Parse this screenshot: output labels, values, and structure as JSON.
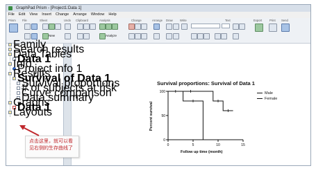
{
  "window": {
    "title": "GraphPad Prism - [Project1:Data 1]"
  },
  "menu": [
    "File",
    "Edit",
    "View",
    "Insert",
    "Change",
    "Arrange",
    "Window",
    "Help"
  ],
  "toolbar": {
    "groups": [
      "Prism",
      "File",
      "Sheet",
      "Undo",
      "Clipboard",
      "Analysis",
      "Change",
      "Arrange",
      "Draw",
      "Write",
      "Text",
      "Export",
      "Print",
      "Send"
    ],
    "new_label": "New",
    "analyze_label": "Analyze",
    "font_combo": "",
    "size_combo": ""
  },
  "navigator": {
    "items": [
      {
        "label": "Family",
        "kind": "folder"
      },
      {
        "label": "Search results",
        "kind": "folder"
      },
      {
        "label": "Data Tables",
        "kind": "folder"
      },
      {
        "label": "Data 1",
        "kind": "doc"
      },
      {
        "label": "Info",
        "kind": "folder"
      },
      {
        "label": "Project info 1",
        "kind": "info"
      },
      {
        "label": "Results",
        "kind": "folder"
      },
      {
        "label": "Survival of Data 1",
        "kind": "folder"
      },
      {
        "label": "Survival proportions",
        "kind": "doc"
      },
      {
        "label": "# of subjects at risk",
        "kind": "doc"
      },
      {
        "label": "Curve comparison",
        "kind": "doc"
      },
      {
        "label": "Data summary",
        "kind": "doc"
      },
      {
        "label": "Graphs",
        "kind": "folder"
      },
      {
        "label": "Data 1",
        "kind": "graph"
      },
      {
        "label": "Layouts",
        "kind": "folder"
      }
    ]
  },
  "annotation": {
    "text": "点击这里，就可以看见右侧的生存曲线了",
    "arrow_color": "#c0282d"
  },
  "chart_data": {
    "type": "line",
    "title": "Survival proportions: Survival of Data 1",
    "xlabel": "Follow up time (month)",
    "ylabel": "Percent survival",
    "xlim": [
      0,
      15
    ],
    "ylim": [
      0,
      100
    ],
    "x_ticks": [
      0,
      5,
      10,
      15
    ],
    "y_ticks": [
      0,
      50,
      100
    ],
    "legend_position": "right",
    "series": [
      {
        "name": "Male",
        "steps": [
          [
            0,
            100
          ],
          [
            3,
            100
          ],
          [
            3,
            80
          ],
          [
            7,
            80
          ],
          [
            7,
            0
          ]
        ]
      },
      {
        "name": "Female",
        "steps": [
          [
            0,
            100
          ],
          [
            9,
            100
          ],
          [
            9,
            80
          ],
          [
            11,
            80
          ],
          [
            11,
            60
          ],
          [
            13,
            60
          ]
        ]
      }
    ]
  }
}
